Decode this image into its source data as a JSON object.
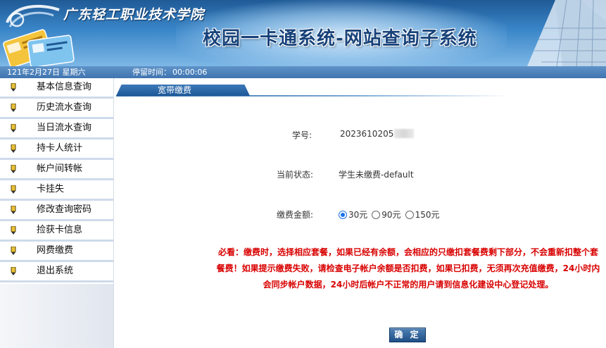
{
  "header": {
    "school_name": "广东轻工职业技术学院",
    "system_title": "校园一卡通系统-网站查询子系统"
  },
  "infobar": {
    "date": "121年2月27日 星期六",
    "stay_label": "停留时间：",
    "stay_value": "00:00:06"
  },
  "sidebar": {
    "items": [
      {
        "label": "基本信息查询"
      },
      {
        "label": "历史流水查询"
      },
      {
        "label": "当日流水查询"
      },
      {
        "label": "持卡人统计"
      },
      {
        "label": "帐户间转帐"
      },
      {
        "label": "卡挂失"
      },
      {
        "label": "修改查询密码"
      },
      {
        "label": "捡获卡信息"
      },
      {
        "label": "网费缴费"
      },
      {
        "label": "退出系统"
      }
    ]
  },
  "main": {
    "tab_label": "宽带缴费",
    "student_id_label": "学号:",
    "student_id_value": "2023610205",
    "status_label": "当前状态:",
    "status_value": "学生未缴费-default",
    "amount_label": "缴费金额:",
    "amount_options": [
      {
        "label": "30元",
        "checked": true
      },
      {
        "label": "90元",
        "checked": false
      },
      {
        "label": "150元",
        "checked": false
      }
    ],
    "notice": "必看：缴费时，选择相应套餐，如果已经有余额，会相应的只缴扣套餐费剩下部分，不会重新扣整个套餐费！如果提示缴费失败，请检查电子帐户余额是否扣费，如果已扣费，无须再次充值缴费，24小时内会同步帐户数据，24小时后帐户不正常的用户请到信息化建设中心登记处理。",
    "confirm_label": "确 定"
  },
  "colors": {
    "banner_dark": "#1f5a96",
    "infobar": "#4f83be",
    "tab": "#2e6aa8",
    "notice_red": "#d90000",
    "radio_selected": "#1a73e8"
  }
}
